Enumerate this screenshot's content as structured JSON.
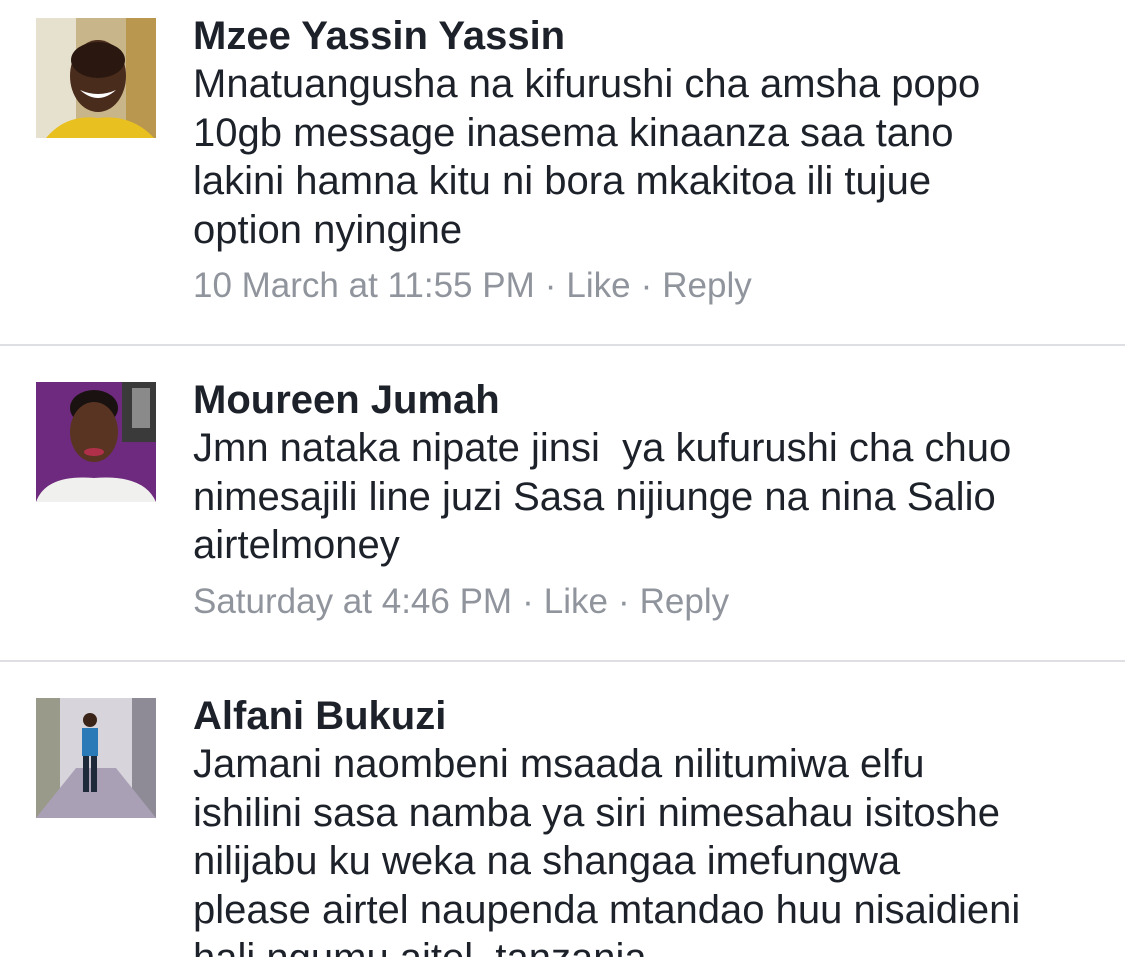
{
  "comments": [
    {
      "author": "Mzee Yassin Yassin",
      "lines": [
        "Mnatuangusha na kifurushi cha amsha popo",
        "10gb message inasema kinaanza saa tano",
        "lakini hamna kitu ni bora mkakitoa ili tujue",
        "option nyingine"
      ],
      "timestamp": "10 March at 11:55 PM",
      "like_label": "Like",
      "reply_label": "Reply",
      "separator": "·"
    },
    {
      "author": "Moureen Jumah",
      "lines": [
        "Jmn nataka nipate jinsi  ya kufurushi cha chuo",
        "nimesajili line juzi Sasa nijiunge na nina Salio",
        "airtelmoney"
      ],
      "timestamp": "Saturday at 4:46 PM",
      "like_label": "Like",
      "reply_label": "Reply",
      "separator": "·"
    },
    {
      "author": "Alfani Bukuzi",
      "lines": [
        "Jamani naombeni msaada nilitumiwa elfu",
        "ishilini sasa namba ya siri nimesahau isitoshe",
        "nilijabu ku weka na shangaa imefungwa",
        "please airtel naupenda mtandao huu nisaidieni",
        "hali ngumu aitel  tanzania"
      ]
    }
  ],
  "colors": {
    "text": "#1d2129",
    "meta": "#90949c",
    "divider": "#dddfe2"
  }
}
